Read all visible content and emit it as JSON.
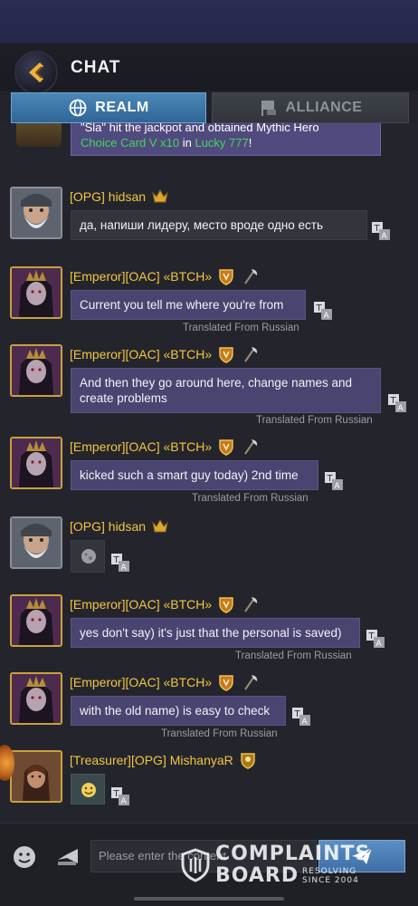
{
  "header": {
    "title": "CHAT",
    "tabs": [
      {
        "label": "REALM",
        "active": true
      },
      {
        "label": "ALLIANCE",
        "active": false
      }
    ]
  },
  "system_message": {
    "line1": "\"Sla\" hit the jackpot and obtained Mythic Hero",
    "line2_part1": "Choice Card V x10",
    "line2_mid": " in ",
    "line2_part2": "Lucky 777",
    "line2_end": "!"
  },
  "messages": [
    {
      "name": "[OPG] hidsan",
      "text": "да, напиши лидеру, место вроде одно есть",
      "translated": ""
    },
    {
      "name": "[Emperor][OAC] «BTCH»",
      "text": "Current you tell me where you're from",
      "translated": "Translated From Russian"
    },
    {
      "name": "[Emperor][OAC] «BTCH»",
      "text": "And then they go around here, change names and create problems",
      "translated": "Translated From Russian"
    },
    {
      "name": "[Emperor][OAC] «BTCH»",
      "text": "kicked such a smart guy today) 2nd time",
      "translated": "Translated From Russian"
    },
    {
      "name": "[OPG] hidsan",
      "text": "",
      "translated": ""
    },
    {
      "name": "[Emperor][OAC] «BTCH»",
      "text": "yes don't say) it's just that the personal is saved)",
      "translated": "Translated From Russian"
    },
    {
      "name": "[Emperor][OAC] «BTCH»",
      "text": "with the old name) is easy to check",
      "translated": "Translated From Russian"
    },
    {
      "name": "[Treasurer][OPG] MishanyaR",
      "text": "",
      "translated": ""
    }
  ],
  "input": {
    "placeholder": "Please enter the content"
  },
  "watermark": {
    "line1": "COMPLAINTS",
    "line2": "BOARD",
    "tag1": "RESOLVING",
    "tag2": "SINCE 2004"
  },
  "colors": {
    "name_gold": "#f1c541",
    "bubble_purple": "#4a4470",
    "system_green": "#41d85a",
    "tab_active": "#3e78aa"
  }
}
